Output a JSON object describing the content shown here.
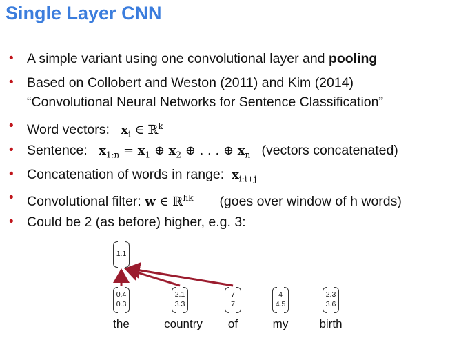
{
  "title": "Single Layer CNN",
  "bullets": {
    "b1_pre": "A simple variant using one convolutional layer and ",
    "b1_bold": "pooling",
    "b2_line1": "Based on Collobert and Weston (2011) and Kim (2014)",
    "b2_line2": "“Convolutional Neural Networks for Sentence Classification”",
    "b3_label": "Word vectors:",
    "b3_math": "x",
    "b3_sub": "i",
    "b3_in": " ∈ ℝ",
    "b3_sup": "k",
    "b4_label": "Sentence:",
    "b4_math": "x",
    "b4_sub1": "1:n",
    "b4_eq": " = ",
    "b4_x1": "x",
    "b4_s1": "1",
    "b4_op1": " ⊕ ",
    "b4_x2": "x",
    "b4_s2": "2",
    "b4_op2": " ⊕ . . . ⊕ ",
    "b4_xn": "x",
    "b4_sn": "n",
    "b4_note": "(vectors concatenated)",
    "b5_label": "Concatenation of words in range:",
    "b5_math": "x",
    "b5_sub": "i:i+j",
    "b6_label": "Convolutional filter:",
    "b6_math": "w",
    "b6_in": " ∈ ℝ",
    "b6_sup": "hk",
    "b6_note": "(goes over window of h words)",
    "b7": "Could be 2 (as before) higher, e.g. 3:"
  },
  "diagram": {
    "output": [
      "1.1"
    ],
    "vectors": [
      {
        "word": "the",
        "values": [
          "0.4",
          "0.3"
        ]
      },
      {
        "word": "country",
        "values": [
          "2.1",
          "3.3"
        ]
      },
      {
        "word": "of",
        "values": [
          "7",
          "7"
        ]
      },
      {
        "word": "my",
        "values": [
          "4",
          "4.5"
        ]
      },
      {
        "word": "birth",
        "values": [
          "2.3",
          "3.6"
        ]
      }
    ],
    "arrow_color": "#9b1c2e"
  }
}
